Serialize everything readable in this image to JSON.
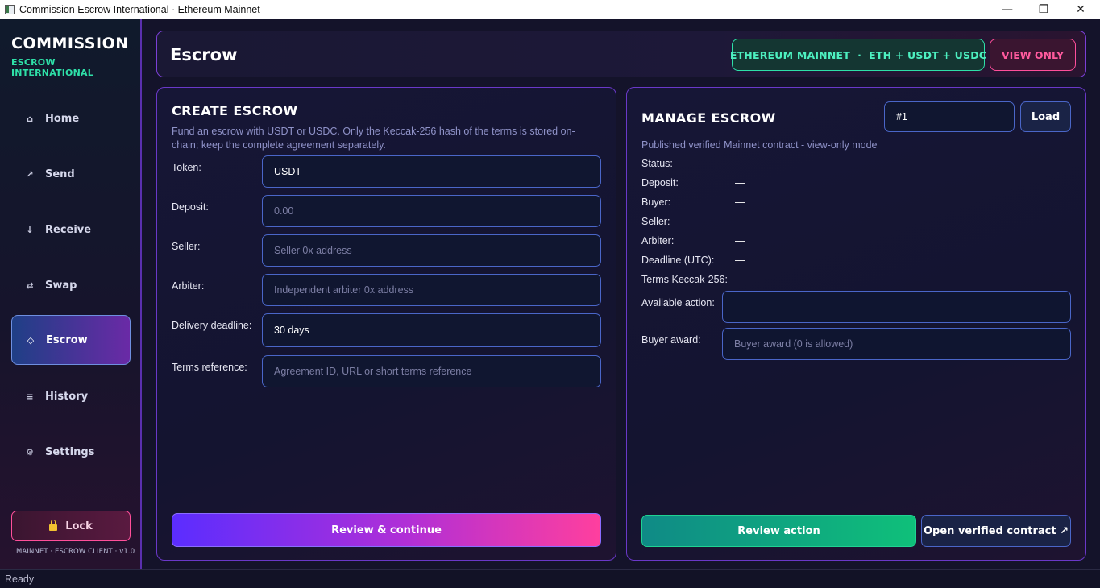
{
  "window": {
    "title": "Commission Escrow International · Ethereum Mainnet",
    "minimize": "—",
    "restore": "❐",
    "close": "✕"
  },
  "sidebar": {
    "brand_title": "COMMISSION",
    "brand_subtitle": "ESCROW INTERNATIONAL",
    "items": [
      {
        "label": "Home",
        "icon": "⌂",
        "icon_name": "home-icon"
      },
      {
        "label": "Send",
        "icon": "↗",
        "icon_name": "send-arrow-icon"
      },
      {
        "label": "Receive",
        "icon": "↓",
        "icon_name": "receive-arrow-icon"
      },
      {
        "label": "Swap",
        "icon": "⇄",
        "icon_name": "swap-icon"
      },
      {
        "label": "Escrow",
        "icon": "◇",
        "icon_name": "diamond-icon",
        "active": true
      },
      {
        "label": "History",
        "icon": "≡",
        "icon_name": "list-icon"
      },
      {
        "label": "Settings",
        "icon": "⚙",
        "icon_name": "gear-icon"
      }
    ],
    "lock_label": "Lock",
    "footer": "MAINNET · ESCROW CLIENT · v1.0"
  },
  "header": {
    "title": "Escrow",
    "network_badge": "ETHEREUM MAINNET  ·  ETH + USDT + USDC",
    "mode_badge": "VIEW ONLY"
  },
  "create": {
    "title": "CREATE ESCROW",
    "description": "Fund an escrow with USDT or USDC. Only the Keccak-256 hash of the terms is stored on-chain; keep the complete agreement separately.",
    "fields": {
      "token": {
        "label": "Token:",
        "value": "USDT"
      },
      "deposit": {
        "label": "Deposit:",
        "placeholder": "0.00"
      },
      "seller": {
        "label": "Seller:",
        "placeholder": "Seller 0x address"
      },
      "arbiter": {
        "label": "Arbiter:",
        "placeholder": "Independent arbiter 0x address"
      },
      "deadline": {
        "label": "Delivery deadline:",
        "value": "30 days"
      },
      "terms": {
        "label": "Terms reference:",
        "placeholder": "Agreement ID, URL or short terms reference"
      }
    },
    "submit_label": "Review & continue"
  },
  "manage": {
    "title": "MANAGE ESCROW",
    "escrow_id": "#1",
    "load_label": "Load",
    "mode_text": "Published verified Mainnet contract - view-only mode",
    "info": [
      {
        "label": "Status:",
        "value": "—"
      },
      {
        "label": "Deposit:",
        "value": "—"
      },
      {
        "label": "Buyer:",
        "value": "—"
      },
      {
        "label": "Seller:",
        "value": "—"
      },
      {
        "label": "Arbiter:",
        "value": "—"
      },
      {
        "label": "Deadline (UTC):",
        "value": "—"
      },
      {
        "label": "Terms Keccak-256:",
        "value": "—"
      }
    ],
    "available_action_label": "Available action:",
    "available_action_value": "",
    "buyer_award_label": "Buyer award:",
    "buyer_award_placeholder": "Buyer award (0 is allowed)",
    "review_action_label": "Review action",
    "open_contract_label": "Open verified contract ↗"
  },
  "statusbar": {
    "text": "Ready"
  },
  "colors": {
    "accent_green": "#2ee0a8",
    "accent_pink": "#ff4f9a",
    "accent_purple": "#6a38c8",
    "input_border": "#4a66c8"
  }
}
